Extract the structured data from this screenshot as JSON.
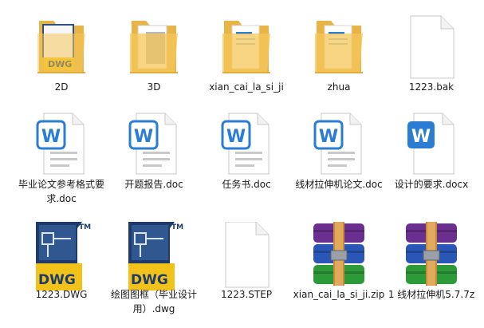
{
  "files": [
    {
      "name": "2D",
      "icon": "folder-icon"
    },
    {
      "name": "3D",
      "icon": "folder-icon"
    },
    {
      "name": "xian_cai_la_si_ji",
      "icon": "folder-icon"
    },
    {
      "name": "zhua",
      "icon": "folder-icon"
    },
    {
      "name": "1223.bak",
      "icon": "blank-file-icon"
    },
    {
      "name": "毕业论文参考格式要求.doc",
      "icon": "word-doc-icon"
    },
    {
      "name": "开题报告.doc",
      "icon": "word-doc-icon"
    },
    {
      "name": "任务书.doc",
      "icon": "word-doc-icon"
    },
    {
      "name": "线材拉伸机论文.doc",
      "icon": "word-doc-icon"
    },
    {
      "name": "设计的要求.docx",
      "icon": "word-docx-icon"
    },
    {
      "name": "1223.DWG",
      "icon": "dwg-file-icon"
    },
    {
      "name": "绘图图框（毕业设计用）.dwg",
      "icon": "dwg-file-icon"
    },
    {
      "name": "1223.STEP",
      "icon": "blank-file-icon"
    },
    {
      "name": "xian_cai_la_si_ji.zip",
      "icon": "winrar-archive-icon"
    },
    {
      "name": "1 线材拉伸机5.7.7z",
      "icon": "winrar-archive-icon"
    }
  ],
  "icon_text": {
    "word": "W",
    "dwg": "DWG",
    "tm": "TM"
  },
  "colors": {
    "folder": "#f5c75a",
    "word_blue": "#2b7cd3",
    "dwg_yellow": "#f0c21a",
    "dwg_navy": "#1f3b6b"
  }
}
